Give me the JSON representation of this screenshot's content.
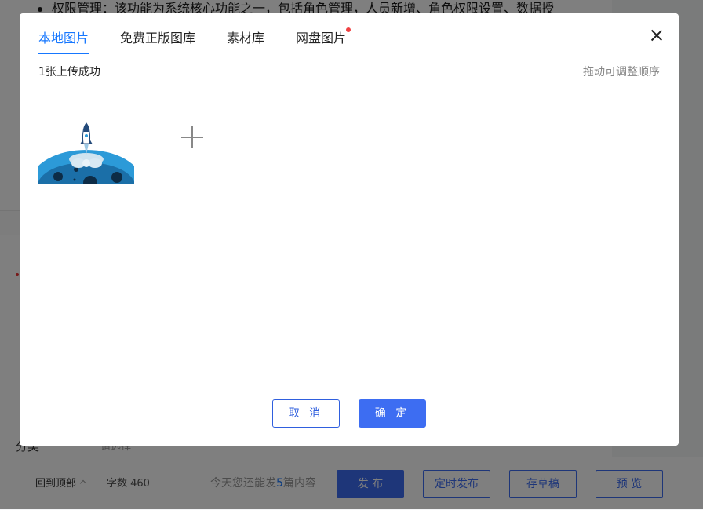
{
  "background": {
    "doc_bullet": "权限管理：该功能为系统核心功能之一，包括角色管理，人员新增、角色权限设置、数据授",
    "category_label": "分类",
    "category_value": "请选择",
    "footer": {
      "back_to_top": "回到顶部",
      "word_count": "字数 460",
      "quota_prefix": "今天您还能发",
      "quota_num": "5",
      "quota_suffix": "篇内容",
      "publish": "发 布",
      "schedule_publish": "定时发布",
      "save_draft": "存草稿",
      "preview": "预 览"
    }
  },
  "modal": {
    "tabs": [
      {
        "label": "本地图片",
        "active": true
      },
      {
        "label": "免费正版图库",
        "active": false
      },
      {
        "label": "素材库",
        "active": false
      },
      {
        "label": "网盘图片",
        "active": false,
        "badge": true
      }
    ],
    "status_text": "1张上传成功",
    "hint_text": "拖动可调整顺序",
    "cancel_label": "取 消",
    "confirm_label": "确 定"
  },
  "colors": {
    "accent": "#1677ff",
    "primary_button": "#3d6df2",
    "badge": "#f04142",
    "overlay": "rgba(0,0,0,0.5)"
  }
}
